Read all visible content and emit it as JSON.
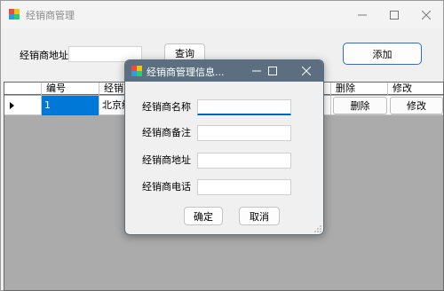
{
  "window": {
    "title": "经销商管理",
    "icon": "app-icon"
  },
  "toolbar": {
    "address_label": "经销商地址",
    "address_value": "",
    "query_label": "查询",
    "add_label": "添加"
  },
  "grid": {
    "columns": [
      "编号",
      "经销商",
      "",
      "",
      "删除",
      "修改"
    ],
    "rows": [
      {
        "id": "1",
        "name": "北京经",
        "delete_label": "删除",
        "edit_label": "修改"
      }
    ]
  },
  "dialog": {
    "title": "经销商管理信息...",
    "fields": [
      {
        "label": "经销商名称",
        "value": ""
      },
      {
        "label": "经销商备注",
        "value": ""
      },
      {
        "label": "经销商地址",
        "value": ""
      },
      {
        "label": "经销商电话",
        "value": ""
      }
    ],
    "ok_label": "确定",
    "cancel_label": "取消"
  },
  "colors": {
    "accent": "#0078d7",
    "dialog_titlebar": "#5b6f81",
    "grid_background": "#ababab"
  }
}
